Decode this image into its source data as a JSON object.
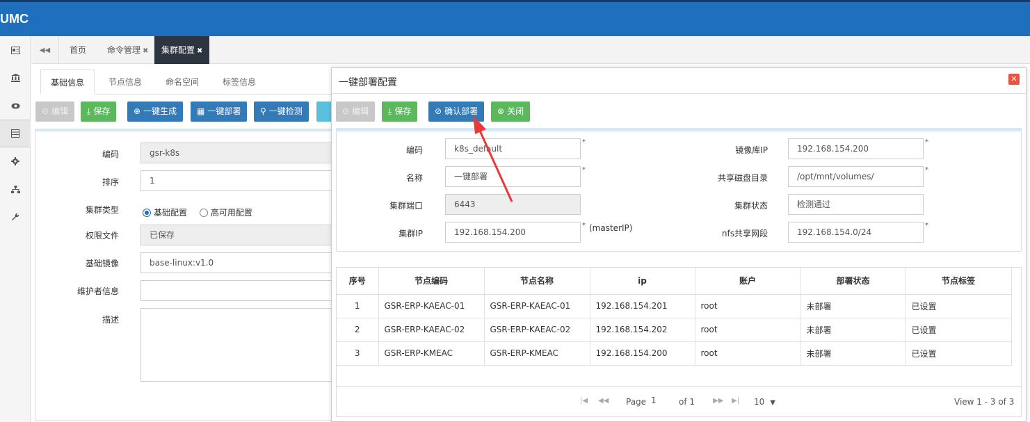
{
  "header": {
    "logo": "UMC"
  },
  "rail": {
    "icons": [
      "id-card-icon",
      "bank-icon",
      "eye-icon",
      "server-icon",
      "gear-icon",
      "sitemap-icon",
      "wrench-icon"
    ]
  },
  "tabs": {
    "home": "首页",
    "command": "命令管理",
    "cluster": "集群配置"
  },
  "subtabs": [
    "基础信息",
    "节点信息",
    "命名空间",
    "标签信息"
  ],
  "toolbar": {
    "edit": "编辑",
    "save": "保存",
    "generate": "一键生成",
    "deploy": "一键部署",
    "check": "一键检测"
  },
  "form": {
    "code_label": "编码",
    "code_value": "gsr-k8s",
    "order_label": "排序",
    "order_value": "1",
    "type_label": "集群类型",
    "type_basic": "基础配置",
    "type_ha": "高可用配置",
    "perm_label": "权限文件",
    "perm_value": "已保存",
    "image_label": "基础镜像",
    "image_value": "base-linux:v1.0",
    "maint_label": "维护者信息",
    "desc_label": "描述"
  },
  "dialog": {
    "title": "一键部署配置",
    "close": "✕",
    "edit": "编辑",
    "save": "保存",
    "confirm": "确认部署",
    "close_btn": "关闭",
    "fields": {
      "code_label": "编码",
      "code_value": "k8s_default",
      "name_label": "名称",
      "name_value": "一键部署",
      "port_label": "集群端口",
      "port_value": "6443",
      "ip_label": "集群IP",
      "ip_value": "192.168.154.200",
      "ip_hint": "(masterIP)",
      "repo_label": "镜像库IP",
      "repo_value": "192.168.154.200",
      "disk_label": "共享磁盘目录",
      "disk_value": "/opt/mnt/volumes/",
      "status_label": "集群状态",
      "status_value": "检测通过",
      "nfs_label": "nfs共享网段",
      "nfs_value": "192.168.154.0/24",
      "req": "*"
    },
    "table": {
      "headers": [
        "序号",
        "节点编码",
        "节点名称",
        "ip",
        "账户",
        "部署状态",
        "节点标签"
      ],
      "rows": [
        [
          "1",
          "GSR-ERP-KAEAC-01",
          "GSR-ERP-KAEAC-01",
          "192.168.154.201",
          "root",
          "未部署",
          "已设置"
        ],
        [
          "2",
          "GSR-ERP-KAEAC-02",
          "GSR-ERP-KAEAC-02",
          "192.168.154.202",
          "root",
          "未部署",
          "已设置"
        ],
        [
          "3",
          "GSR-ERP-KMEAC",
          "GSR-ERP-KMEAC",
          "192.168.154.200",
          "root",
          "未部署",
          "已设置"
        ]
      ]
    },
    "pager": {
      "page_label": "Page",
      "page_value": "1",
      "of_label": "of 1",
      "page_size": "10",
      "summary": "View 1 - 3 of 3"
    }
  },
  "colors": {
    "header": "#1e6fbd",
    "green": "#5cb85c",
    "blue": "#337ab7",
    "arrow": "#e8383a"
  }
}
